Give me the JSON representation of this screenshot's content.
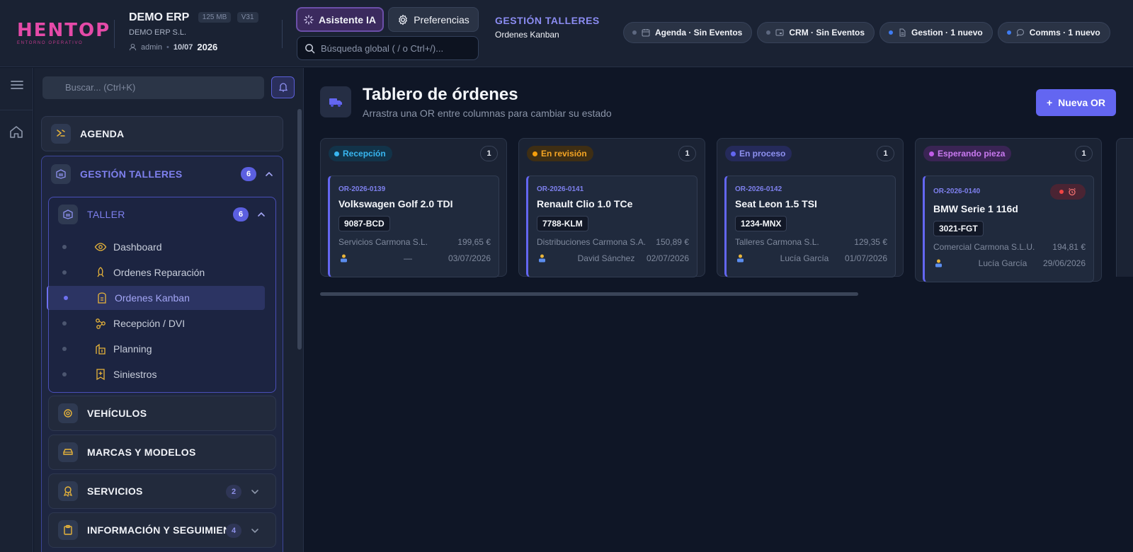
{
  "app": {
    "logo_text": "HENTOP",
    "logo_subtitle": "ENTORNO OPERATIVO",
    "company_name": "DEMO ERP",
    "size_chip": "125 MB",
    "version_chip": "V31",
    "company_legal": "DEMO ERP S.L.",
    "user": "admin",
    "date_short": "10/07",
    "year": "2026"
  },
  "header": {
    "ai_button": "Asistente IA",
    "prefs_button": "Preferencias",
    "search_placeholder": "Búsqueda global ( / o Ctrl+/)...",
    "section": "GESTIÓN TALLERES",
    "subsection": "Ordenes Kanban",
    "pills": [
      {
        "label": "Agenda · Sin Eventos",
        "icon": "calendar-icon",
        "active": false
      },
      {
        "label": "CRM · Sin Eventos",
        "icon": "crm-icon",
        "active": false
      },
      {
        "label": "Gestion · 1 nuevo",
        "icon": "document-icon",
        "active": true
      },
      {
        "label": "Comms · 1 nuevo",
        "icon": "chat-icon",
        "active": true
      }
    ]
  },
  "sidebar": {
    "search_placeholder": "Buscar... (Ctrl+K)",
    "agenda": "AGENDA",
    "gestion_talleres": {
      "label": "GESTIÓN TALLERES",
      "badge": "6"
    },
    "taller": {
      "label": "TALLER",
      "badge": "6"
    },
    "taller_items": [
      {
        "label": "Dashboard",
        "active": false
      },
      {
        "label": "Ordenes Reparación",
        "active": false
      },
      {
        "label": "Ordenes Kanban",
        "active": true
      },
      {
        "label": "Recepción / DVI",
        "active": false
      },
      {
        "label": "Planning",
        "active": false
      },
      {
        "label": "Siniestros",
        "active": false
      }
    ],
    "groups": [
      {
        "label": "VEHÍCULOS"
      },
      {
        "label": "MARCAS Y MODELOS"
      },
      {
        "label": "SERVICIOS",
        "badge": "2"
      },
      {
        "label": "INFORMACIÓN Y SEGUIMIEN...",
        "badge": "4"
      }
    ]
  },
  "main": {
    "title": "Tablero de órdenes",
    "subtitle": "Arrastra una OR entre columnas para cambiar su estado",
    "new_button": "Nueva OR",
    "columns": [
      {
        "status": "Recepción",
        "count": "1",
        "color": "#38b6f0",
        "card": {
          "code": "OR-2026-0139",
          "vehicle": "Volkswagen Golf 2.0 TDI",
          "plate": "9087-BCD",
          "client": "Servicios Carmona S.L.",
          "amount": "199,65 €",
          "person": "—",
          "date": "03/07/2026"
        }
      },
      {
        "status": "En revisión",
        "count": "1",
        "color": "#f59e0b",
        "card": {
          "code": "OR-2026-0141",
          "vehicle": "Renault Clio 1.0 TCe",
          "plate": "7788-KLM",
          "client": "Distribuciones Carmona S.A.",
          "amount": "150,89 €",
          "person": "David Sánchez",
          "date": "02/07/2026"
        }
      },
      {
        "status": "En proceso",
        "count": "1",
        "color": "#6366f1",
        "card": {
          "code": "OR-2026-0142",
          "vehicle": "Seat Leon 1.5 TSI",
          "plate": "1234-MNX",
          "client": "Talleres Carmona S.L.",
          "amount": "129,35 €",
          "person": "Lucía García",
          "date": "01/07/2026"
        }
      },
      {
        "status": "Esperando pieza",
        "count": "1",
        "color": "#c05ce8",
        "card": {
          "code": "OR-2026-0140",
          "vehicle": "BMW Serie 1 116d",
          "plate": "3021-FGT",
          "client": "Comercial Carmona S.L.U.",
          "amount": "194,81 €",
          "person": "Lucía García",
          "date": "29/06/2026",
          "alarm": true
        }
      }
    ]
  }
}
